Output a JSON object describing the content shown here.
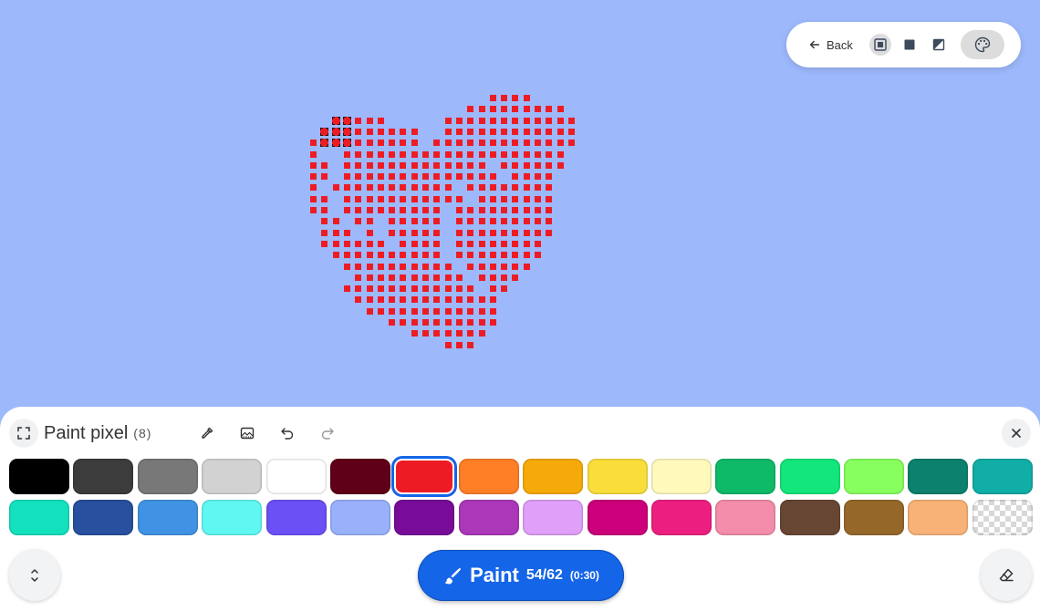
{
  "toolbar": {
    "back_label": "Back",
    "icons": [
      "frame-icon",
      "square-icon",
      "contrast-icon",
      "palette-icon"
    ]
  },
  "panel": {
    "title": "Paint pixel",
    "count": "(8)",
    "tools": [
      "eyedropper-icon",
      "image-icon",
      "undo-icon",
      "redo-icon"
    ]
  },
  "palette": {
    "colors": [
      "#000000",
      "#3c3c3c",
      "#787878",
      "#d2d2d2",
      "#ffffff",
      "#600018",
      "#ed1c24",
      "#ff7f27",
      "#f6aa09",
      "#f9dd3b",
      "#fffabc",
      "#0eb968",
      "#13e67b",
      "#87ff5e",
      "#0c816e",
      "#10aea6",
      "#13e1be",
      "#28509e",
      "#4093e4",
      "#60f7f2",
      "#6b50f6",
      "#99b1fb",
      "#780c99",
      "#aa38b9",
      "#e09ff9",
      "#cb007a",
      "#ec1f80",
      "#f38da9",
      "#684634",
      "#95682a",
      "#f8b277",
      "transparent"
    ],
    "selected_index": 6
  },
  "paint_button": {
    "label": "Paint",
    "count": "54/62",
    "timer": "(0:30)"
  },
  "colors": {
    "background": "#9db9fc",
    "pixel": "#ed1c24",
    "accent": "#1565e8"
  }
}
